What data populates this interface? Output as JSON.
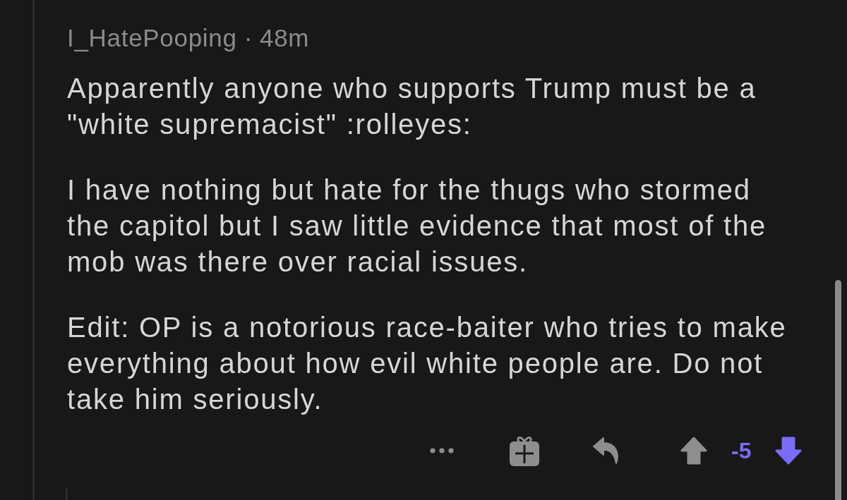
{
  "comment": {
    "author": "I_HatePooping",
    "separator": "·",
    "age": "48m",
    "paragraphs": [
      "Apparently anyone who supports Trump must be a \"white supremacist\" :rolleyes:",
      "I have nothing but hate for the thugs who stormed the capitol but I saw little evidence that most of the mob was there over racial issues.",
      "Edit: OP is a notorious race-baiter who tries to make everything about how evil white people are. Do not take him seriously."
    ]
  },
  "actions": [
    {
      "kind": "more"
    },
    {
      "kind": "award"
    },
    {
      "kind": "reply"
    }
  ],
  "vote": {
    "upvoted": false,
    "score": "-5",
    "downvoted": true
  }
}
